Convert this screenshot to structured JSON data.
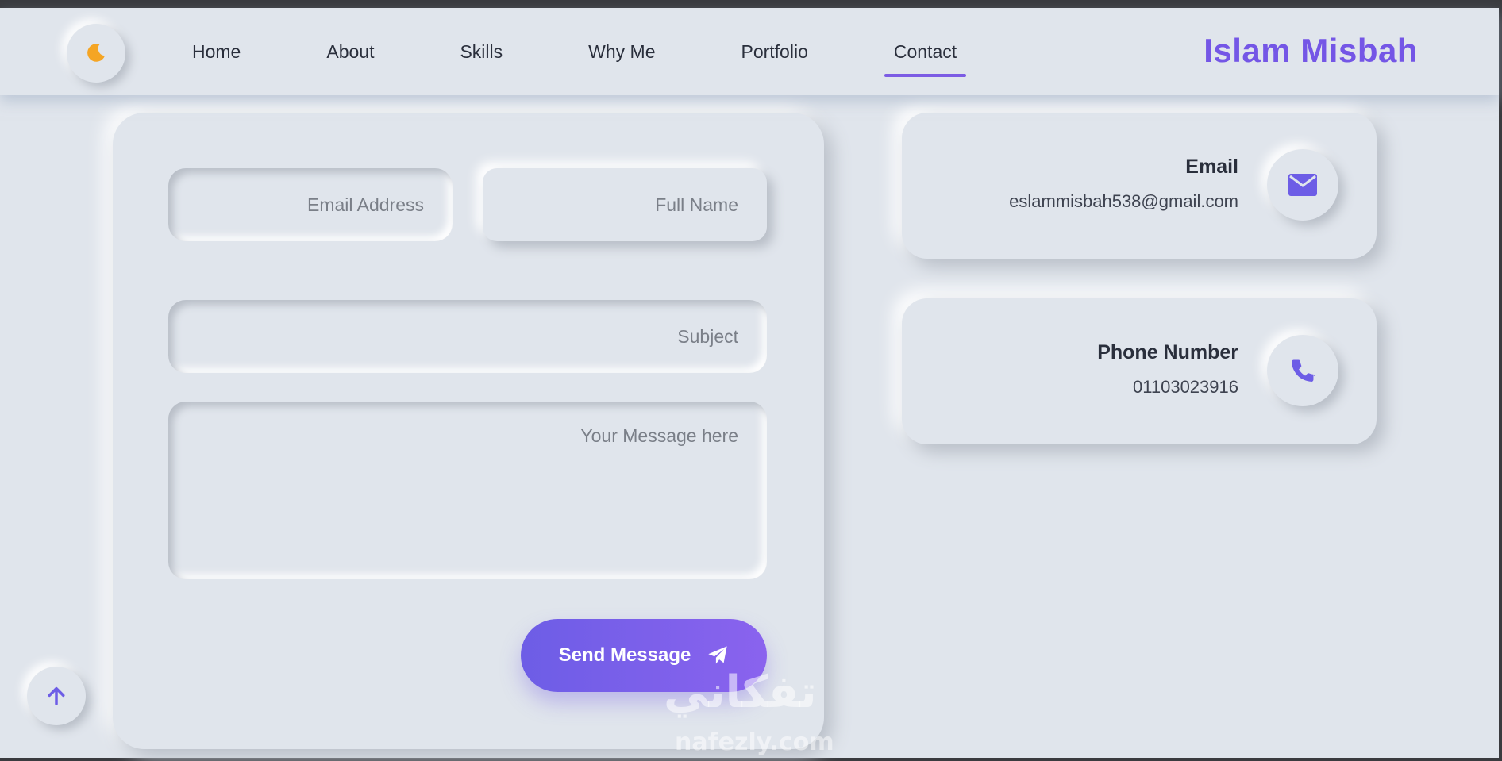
{
  "header": {
    "brand": "Islam Misbah",
    "theme_icon": "moon-icon",
    "nav": [
      {
        "label": "Home"
      },
      {
        "label": "About"
      },
      {
        "label": "Skills"
      },
      {
        "label": "Why Me"
      },
      {
        "label": "Portfolio"
      },
      {
        "label": "Contact",
        "active": true
      }
    ]
  },
  "form": {
    "email_placeholder": "Email Address",
    "name_placeholder": "Full Name",
    "subject_placeholder": "Subject",
    "message_placeholder": "Your Message here",
    "send_label": "Send Message",
    "send_icon": "paper-plane-icon"
  },
  "contact_info": [
    {
      "title": "Email",
      "value": "eslammisbah538@gmail.com",
      "icon": "envelope-icon"
    },
    {
      "title": "Phone Number",
      "value": "01103023916",
      "icon": "phone-icon"
    }
  ],
  "scroll_top_icon": "arrow-up-icon",
  "watermark": {
    "main": "تفكاني",
    "sub": "nafezly.com"
  },
  "colors": {
    "background": "#e0e5ec",
    "accent": "#7456e6",
    "moon": "#f5a524"
  }
}
